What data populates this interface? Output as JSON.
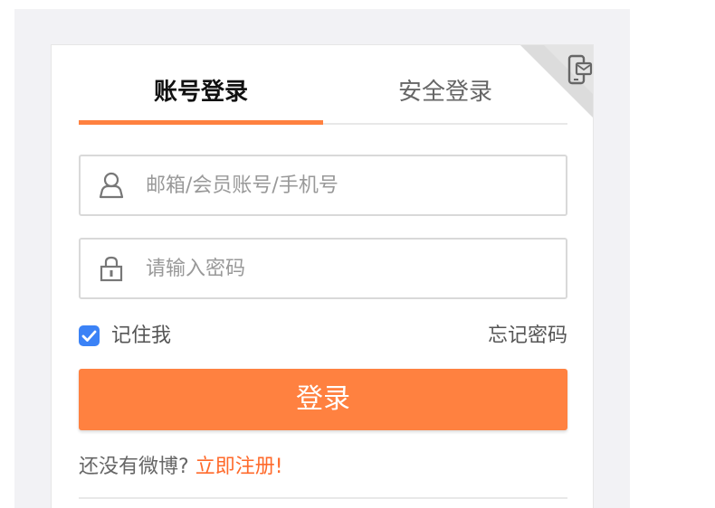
{
  "tabs": {
    "account_login": "账号登录",
    "secure_login": "安全登录"
  },
  "form": {
    "username_placeholder": "邮箱/会员账号/手机号",
    "username_value": "",
    "password_placeholder": "请输入密码",
    "password_value": "",
    "remember_label": "记住我",
    "remember_checked": true,
    "forgot_label": "忘记密码",
    "login_label": "登录"
  },
  "register": {
    "prompt": "还没有微博?",
    "link": "立即注册!"
  },
  "icons": {
    "corner": "qr-login-icon",
    "user": "user-icon",
    "password": "lock-icon",
    "checkbox": "checkmark-icon"
  },
  "colors": {
    "accent": "#ff8140",
    "link": "#ff6a2b",
    "checkbox": "#3b82f6",
    "background": "#f2f2f5"
  }
}
